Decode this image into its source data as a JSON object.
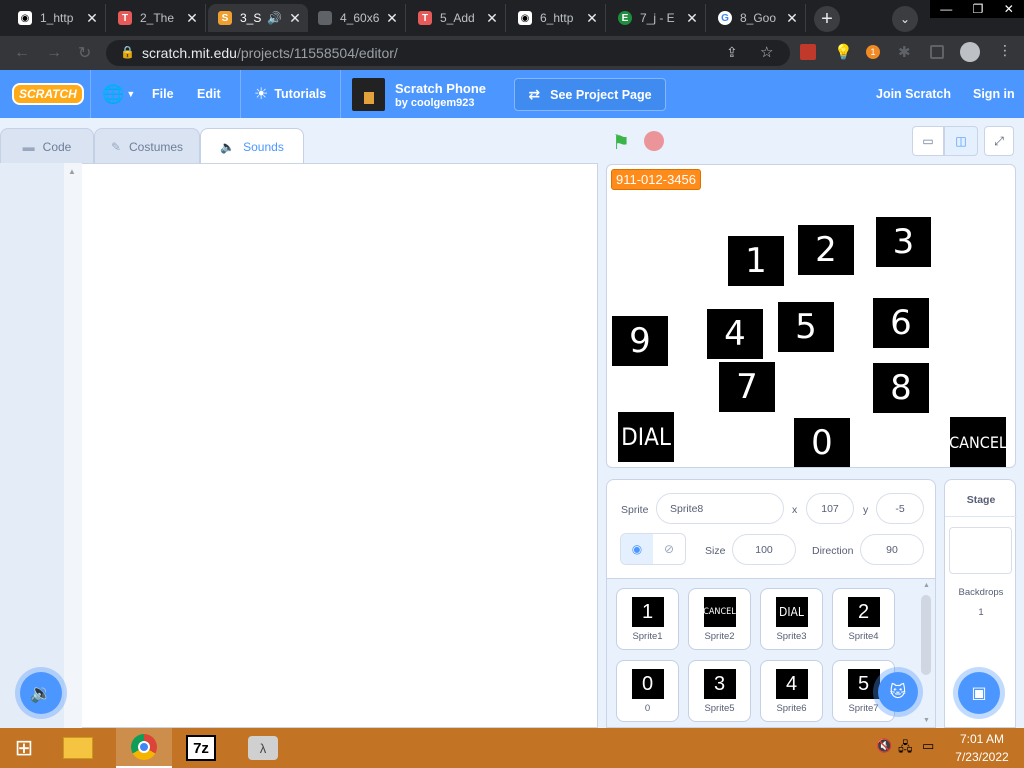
{
  "browser": {
    "tabs": [
      {
        "label": "1_http",
        "fav": "github-icon",
        "color": "#ffffff"
      },
      {
        "label": "2_The",
        "fav": "tumblr-icon",
        "color": "#e65a5a"
      },
      {
        "label": "3_S",
        "fav": "scratch-icon",
        "color": "#f0a030",
        "active": true
      },
      {
        "label": "4_60x6",
        "fav": "globe-icon",
        "color": "#5f6368"
      },
      {
        "label": "5_Add",
        "fav": "tumblr-icon",
        "color": "#e65a5a"
      },
      {
        "label": "6_http",
        "fav": "github-icon",
        "color": "#ffffff"
      },
      {
        "label": "7_j - E",
        "fav": "e-icon",
        "color": "#1e8e3e"
      },
      {
        "label": "8_Goo",
        "fav": "google-icon",
        "color": "#ffffff"
      }
    ],
    "url_host": "scratch.mit.edu",
    "url_path": "/projects/11558504/editor/",
    "ext_badge": "1"
  },
  "menu": {
    "logo": "SCRATCH",
    "file": "File",
    "edit": "Edit",
    "tutorials": "Tutorials",
    "project_title": "Scratch Phone",
    "project_author": "by coolgem923",
    "see_project": "See Project Page",
    "join": "Join Scratch",
    "signin": "Sign in"
  },
  "editor_tabs": {
    "code": "Code",
    "costumes": "Costumes",
    "sounds": "Sounds"
  },
  "stage": {
    "monitor": "911-012-3456",
    "keys": [
      "1",
      "2",
      "3",
      "4",
      "5",
      "6",
      "7",
      "8",
      "9",
      "0",
      "DIAL",
      "CANCEL"
    ]
  },
  "sprite_info": {
    "sprite_label": "Sprite",
    "sprite_name": "Sprite8",
    "x_label": "x",
    "x": "107",
    "y_label": "y",
    "y": "-5",
    "size_label": "Size",
    "size": "100",
    "direction_label": "Direction",
    "direction": "90"
  },
  "sprites": [
    {
      "thumb": "1",
      "name": "Sprite1"
    },
    {
      "thumb": "CANCEL",
      "name": "Sprite2"
    },
    {
      "thumb": "DIAL",
      "name": "Sprite3"
    },
    {
      "thumb": "2",
      "name": "Sprite4"
    },
    {
      "thumb": "0",
      "name": "0"
    },
    {
      "thumb": "3",
      "name": "Sprite5"
    },
    {
      "thumb": "4",
      "name": "Sprite6"
    },
    {
      "thumb": "5",
      "name": "Sprite7"
    }
  ],
  "stage_panel": {
    "title": "Stage",
    "backdrops_label": "Backdrops",
    "backdrops_count": "1"
  },
  "taskbar": {
    "time": "7:01 AM",
    "date": "7/23/2022"
  },
  "colors": {
    "scratch_blue": "#4c97ff",
    "monitor_orange": "#ff8c1a",
    "taskbar": "#c27424"
  }
}
